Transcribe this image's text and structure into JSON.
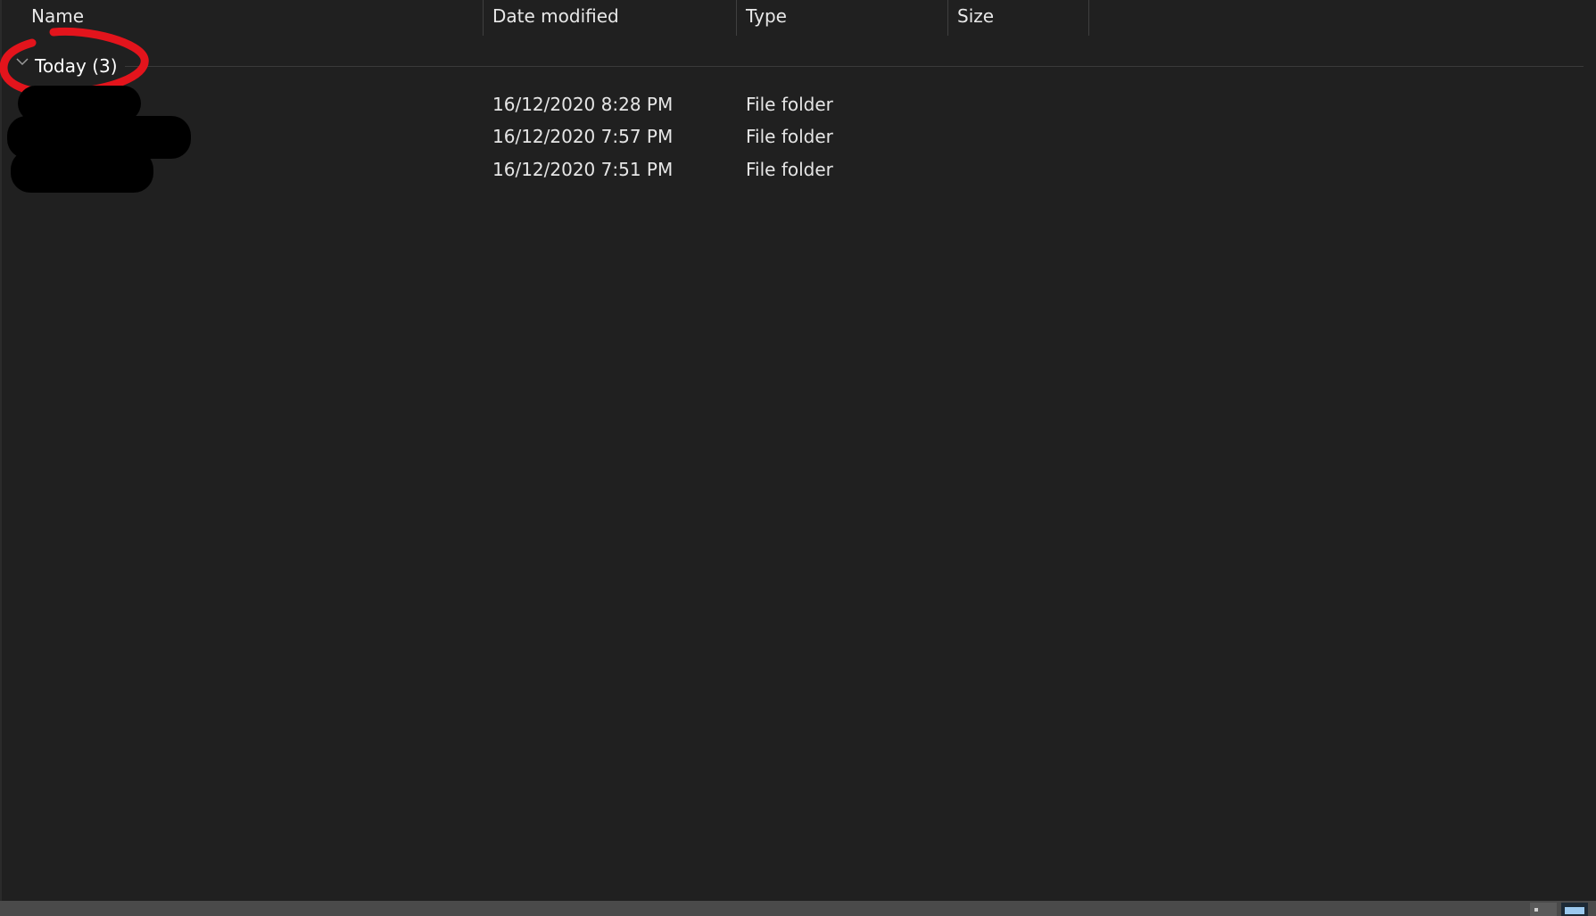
{
  "columns": {
    "name": "Name",
    "date_modified": "Date modified",
    "type": "Type",
    "size": "Size"
  },
  "group": {
    "label": "Today (3)",
    "expanded": true,
    "icon": "chevron-down-icon"
  },
  "rows": [
    {
      "name": "",
      "date_modified": "16/12/2020 8:28 PM",
      "type": "File folder",
      "size": ""
    },
    {
      "name": "",
      "date_modified": "16/12/2020 7:57 PM",
      "type": "File folder",
      "size": ""
    },
    {
      "name": "",
      "date_modified": "16/12/2020 7:51 PM",
      "type": "File folder",
      "size": ""
    }
  ],
  "colors": {
    "background": "#202020",
    "annotation": "#e3141c",
    "redaction": "#000000"
  },
  "status_bar": {
    "view_buttons": [
      "details-view-icon",
      "large-icons-view-icon"
    ]
  }
}
